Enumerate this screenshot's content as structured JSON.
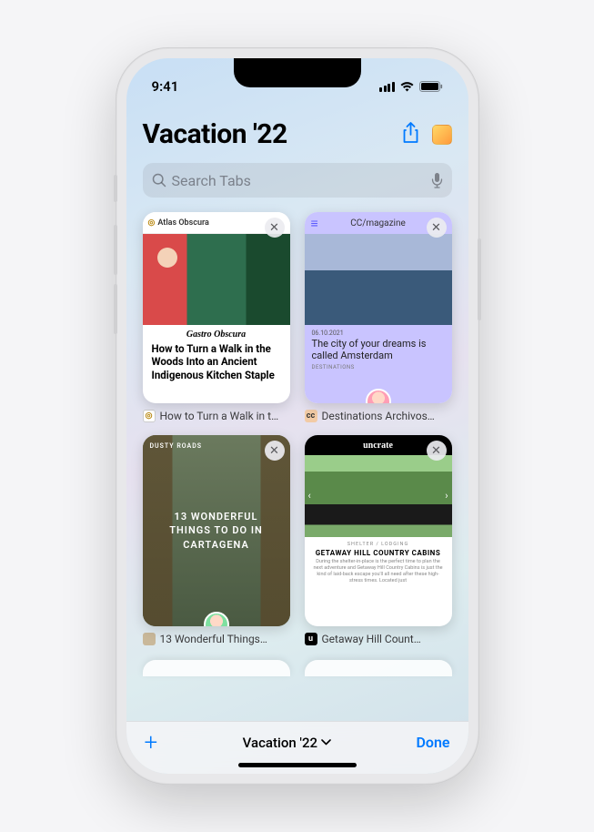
{
  "status": {
    "time": "9:41"
  },
  "header": {
    "title": "Vacation '22",
    "share_icon": "share-icon",
    "avatar_icon": "shared-group-avatar"
  },
  "search": {
    "placeholder": "Search Tabs"
  },
  "tabs": [
    {
      "site_bar_label": "Atlas Obscura",
      "sub_brand": "Gastro Obscura",
      "headline": "How to Turn a Walk in the Woods Into an Ancient Indigenous Kitchen Staple",
      "caption": "How to Turn a Walk in t…",
      "favicon_text": "◎"
    },
    {
      "site_bar_label": "CC/magazine",
      "date": "06.10.2021",
      "headline": "The city of your dreams is called Amsterdam",
      "tag": "DESTINATIONS",
      "caption": "Destinations Archivos…",
      "favicon_text": "cc"
    },
    {
      "site_bar_label": "DUSTY ROADS",
      "headline": "13 WONDERFUL THINGS TO DO IN CARTAGENA",
      "caption": "13 Wonderful Things…",
      "favicon_text": ""
    },
    {
      "site_bar_label": "uncrate",
      "category": "SHELTER / LODGING",
      "title": "GETAWAY HILL COUNTRY CABINS",
      "description": "During the shelter-in-place is the perfect time to plan the next adventure and Getaway Hill Country Cabins is just the kind of laid-back escape you'll all need after these high-stress times. Located just",
      "caption": "Getaway Hill Count…",
      "favicon_text": "u"
    }
  ],
  "bottom": {
    "group_label": "Vacation '22",
    "done_label": "Done"
  },
  "colors": {
    "accent": "#007aff"
  }
}
